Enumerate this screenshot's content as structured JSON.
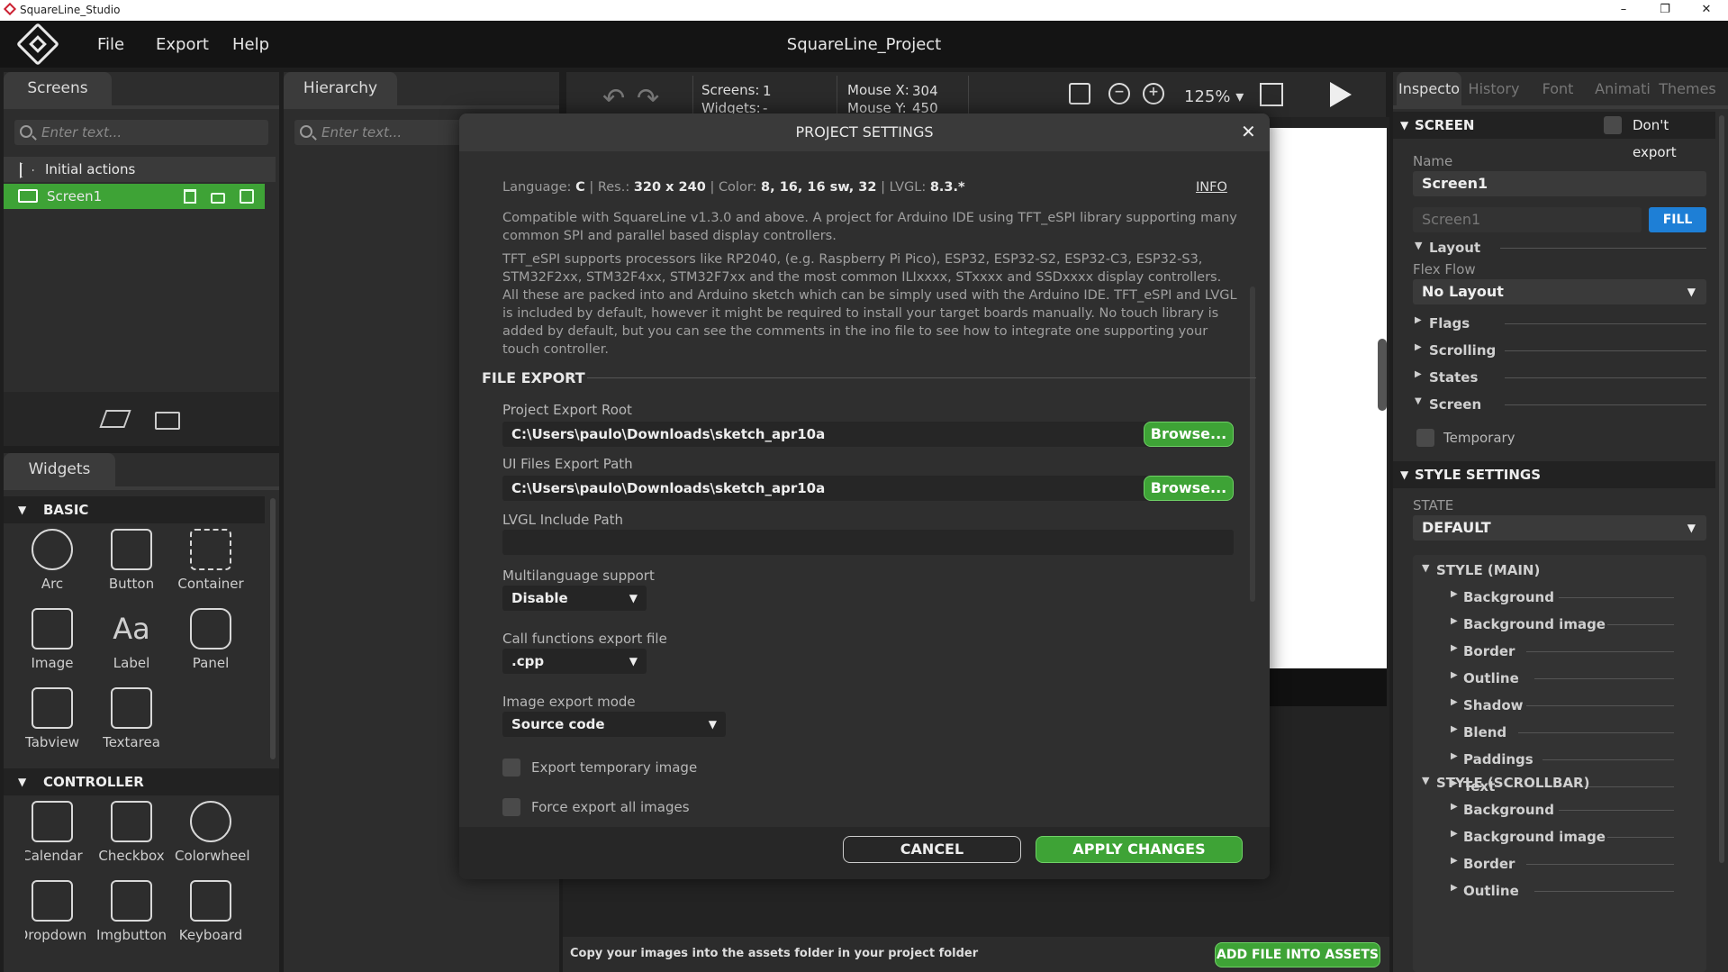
{
  "window": {
    "title": "SquareLine_Studio",
    "minimize": "–",
    "maximize": "❐",
    "close": "✕"
  },
  "menu": {
    "file": "File",
    "export": "Export",
    "help": "Help",
    "project": "SquareLine_Project"
  },
  "screens_panel": {
    "tab": "Screens",
    "search_placeholder": "Enter text...",
    "initial_actions": "Initial actions",
    "screen1": "Screen1"
  },
  "hierarchy_panel": {
    "tab": "Hierarchy",
    "search_placeholder": "Enter text..."
  },
  "widgets_panel": {
    "tab": "Widgets",
    "basic": "BASIC",
    "controller": "CONTROLLER",
    "basic_items": [
      "Arc",
      "Button",
      "Container",
      "Image",
      "Label",
      "Panel",
      "Tabview",
      "Textarea"
    ],
    "controller_items": [
      "Calendar",
      "Checkbox",
      "Colorwheel",
      "Dropdown",
      "Imgbutton",
      "Keyboard"
    ]
  },
  "toolbar": {
    "screens_label": "Screens:",
    "screens_val": "1",
    "widgets_label": "Widgets:",
    "widgets_val": "-",
    "mousex_label": "Mouse X:",
    "mousex_val": "304",
    "mousey_label": "Mouse Y:",
    "mousey_val": "450",
    "zoom": "125%"
  },
  "dialog": {
    "title": "PROJECT SETTINGS",
    "close": "✕",
    "info_lang_label": "Language:",
    "info_lang": "C",
    "info_res_label": "Res.:",
    "info_res": "320 x 240",
    "info_color_label": "Color:",
    "info_color": "8, 16, 16 sw, 32",
    "info_lvgl_label": "LVGL:",
    "info_lvgl": "8.3.*",
    "info_link": "INFO",
    "para1": "Compatible with SquareLine v1.3.0 and above. A project for Arduino IDE using TFT_eSPI library supporting many common SPI and parallel based display controllers.",
    "para2": "TFT_eSPI supports processors like RP2040, (e.g. Raspberry Pi Pico), ESP32, ESP32-S2, ESP32-C3, ESP32-S3, STM32F2xx, STM32F4xx, STM32F7xx and the most common ILIxxxx, STxxxx and SSDxxxx display controllers. All these are packed into and Arduino sketch which can be simply used with the Arduino IDE. TFT_eSPI and LVGL is included by default, however it might be required to install your target boards manually.  No touch library is added by default, but you can see the comments in the ino file to see how to integrate one supporting your touch controller.",
    "file_export": "FILE EXPORT",
    "export_root_label": "Project Export Root",
    "export_root": "C:\\Users\\paulo\\Downloads\\sketch_apr10a",
    "ui_path_label": "UI Files Export Path",
    "ui_path": "C:\\Users\\paulo\\Downloads\\sketch_apr10a",
    "browse": "Browse...",
    "lvgl_include_label": "LVGL Include Path",
    "lvgl_include": "",
    "multilang_label": "Multilanguage support",
    "multilang": "Disable",
    "callfn_label": "Call functions export file",
    "callfn": ".cpp",
    "imgmode_label": "Image export mode",
    "imgmode": "Source code",
    "export_temp": "Export temporary image",
    "force_export": "Force export all images",
    "cancel": "CANCEL",
    "apply": "APPLY CHANGES"
  },
  "assets": {
    "hint": "Copy your images into the assets folder in your project folder",
    "add": "ADD FILE INTO ASSETS"
  },
  "inspector": {
    "tabs": [
      "Inspecto",
      "History",
      "Font",
      "Animati",
      "Themes"
    ],
    "screen": "SCREEN",
    "dont_export": "Don't export",
    "name_label": "Name",
    "name": "Screen1",
    "name2": "Screen1",
    "fill": "FILL",
    "layout": "Layout",
    "flexflow_label": "Flex Flow",
    "flexflow": "No Layout",
    "flags": "Flags",
    "scrolling": "Scrolling",
    "states": "States",
    "screen_sec": "Screen",
    "temporary": "Temporary",
    "style_settings": "STYLE SETTINGS",
    "state_label": "STATE",
    "state": "DEFAULT",
    "style_main": "STYLE (MAIN)",
    "main_items": [
      "Background",
      "Background image",
      "Border",
      "Outline",
      "Shadow",
      "Blend",
      "Paddings",
      "Text"
    ],
    "style_scroll": "STYLE (SCROLLBAR)",
    "scroll_items": [
      "Background",
      "Background image",
      "Border",
      "Outline"
    ]
  },
  "colors": {
    "accent_green": "#3ea336",
    "fill_blue": "#1e7fd6"
  }
}
